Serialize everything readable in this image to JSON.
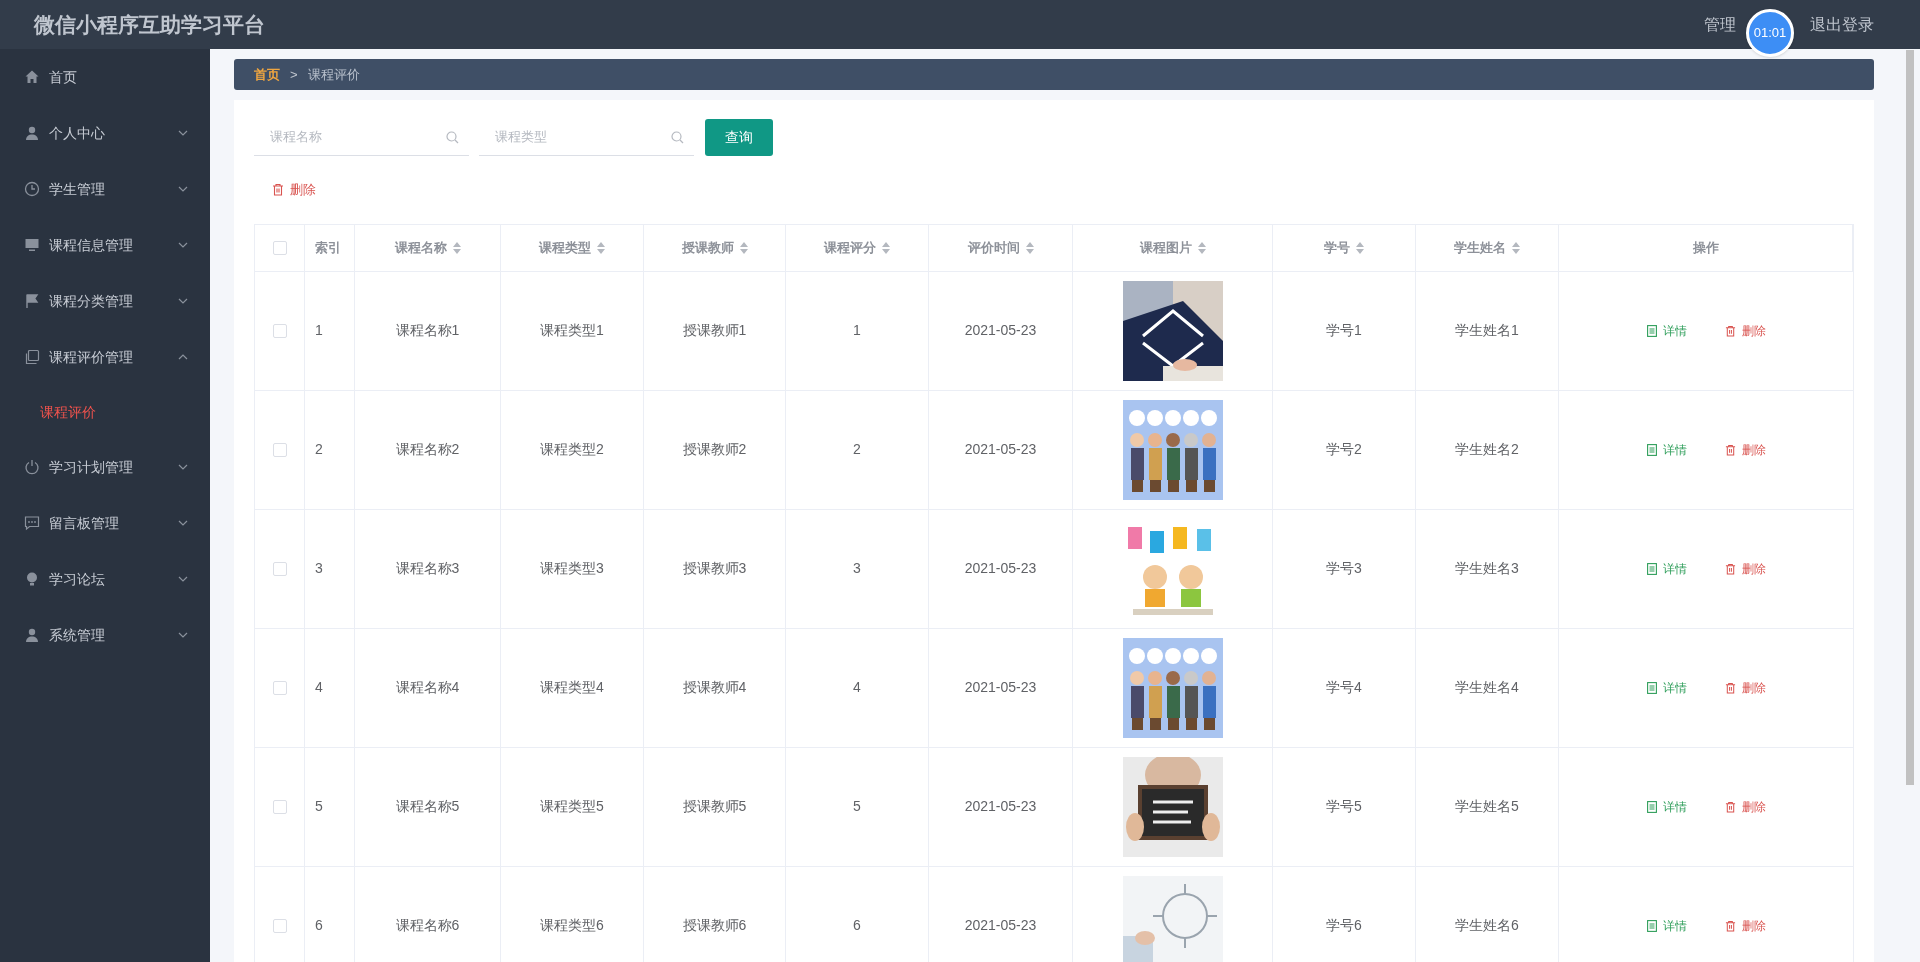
{
  "header": {
    "title": "微信小程序互助学习平台",
    "user": "管理",
    "logout": "退出登录",
    "timer": "01:01"
  },
  "sidebar": {
    "items": [
      {
        "label": "首页"
      },
      {
        "label": "个人中心",
        "expanded": false
      },
      {
        "label": "学生管理",
        "expanded": false
      },
      {
        "label": "课程信息管理",
        "expanded": false
      },
      {
        "label": "课程分类管理",
        "expanded": false
      },
      {
        "label": "课程评价管理",
        "expanded": true,
        "children": [
          {
            "label": "课程评价",
            "selected": true
          }
        ]
      },
      {
        "label": "学习计划管理",
        "expanded": false
      },
      {
        "label": "留言板管理",
        "expanded": false
      },
      {
        "label": "学习论坛",
        "expanded": false
      },
      {
        "label": "系统管理",
        "expanded": false
      }
    ]
  },
  "breadcrumb": {
    "items": [
      "首页",
      "课程评价"
    ],
    "separator": ">"
  },
  "search": {
    "fields": [
      {
        "placeholder": "课程名称"
      },
      {
        "placeholder": "课程类型"
      }
    ],
    "button": "查询"
  },
  "delete_button": "删除",
  "table": {
    "all_checked": false,
    "columns": [
      {
        "label": "索引",
        "sortable": false
      },
      {
        "label": "课程名称",
        "sortable": true
      },
      {
        "label": "课程类型",
        "sortable": true
      },
      {
        "label": "授课教师",
        "sortable": true
      },
      {
        "label": "课程评分",
        "sortable": true
      },
      {
        "label": "评价时间",
        "sortable": true
      },
      {
        "label": "课程图片",
        "sortable": true
      },
      {
        "label": "学号",
        "sortable": true
      },
      {
        "label": "学生姓名",
        "sortable": true
      },
      {
        "label": "操作",
        "sortable": false
      }
    ],
    "rows": [
      {
        "checked": false,
        "cells": [
          "1",
          "课程名称1",
          "课程类型1",
          "授课教师1",
          "1",
          "2021-05-23"
        ],
        "tail": [
          "学号1",
          "学生姓名1"
        ],
        "actions": [
          "详情",
          "删除"
        ]
      },
      {
        "checked": false,
        "cells": [
          "2",
          "课程名称2",
          "课程类型2",
          "授课教师2",
          "2",
          "2021-05-23"
        ],
        "tail": [
          "学号2",
          "学生姓名2"
        ],
        "actions": [
          "详情",
          "删除"
        ]
      },
      {
        "checked": false,
        "cells": [
          "3",
          "课程名称3",
          "课程类型3",
          "授课教师3",
          "3",
          "2021-05-23"
        ],
        "tail": [
          "学号3",
          "学生姓名3"
        ],
        "actions": [
          "详情",
          "删除"
        ]
      },
      {
        "checked": false,
        "cells": [
          "4",
          "课程名称4",
          "课程类型4",
          "授课教师4",
          "4",
          "2021-05-23"
        ],
        "tail": [
          "学号4",
          "学生姓名4"
        ],
        "actions": [
          "详情",
          "删除"
        ]
      },
      {
        "checked": false,
        "cells": [
          "5",
          "课程名称5",
          "课程类型5",
          "授课教师5",
          "5",
          "2021-05-23"
        ],
        "tail": [
          "学号5",
          "学生姓名5"
        ],
        "actions": [
          "详情",
          "删除"
        ]
      },
      {
        "checked": false,
        "cells": [
          "6",
          "课程名称6",
          "课程类型6",
          "授课教师6",
          "6",
          "2021-05-23"
        ],
        "tail": [
          "学号6",
          "学生姓名6"
        ],
        "actions": [
          "详情",
          "删除"
        ]
      }
    ]
  }
}
